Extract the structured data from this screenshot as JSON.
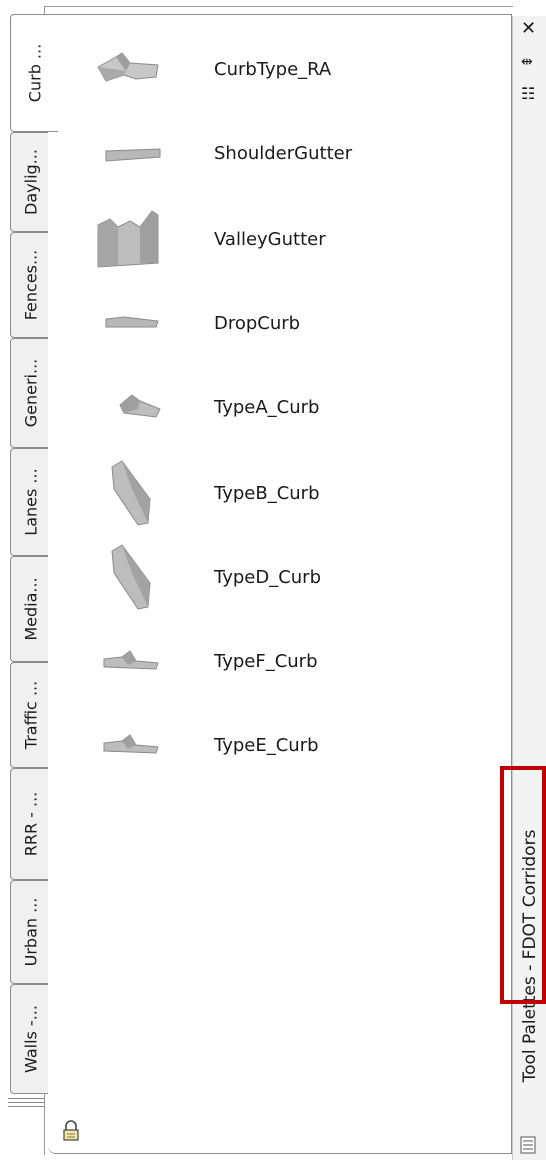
{
  "tabs": [
    {
      "label": "Curb ...",
      "active": true
    },
    {
      "label": "Daylig...",
      "active": false
    },
    {
      "label": "Fences...",
      "active": false
    },
    {
      "label": "Generi...",
      "active": false
    },
    {
      "label": "Lanes ...",
      "active": false
    },
    {
      "label": "Media...",
      "active": false
    },
    {
      "label": "Traffic ...",
      "active": false
    },
    {
      "label": "RRR - ...",
      "active": false
    },
    {
      "label": "Urban ...",
      "active": false
    },
    {
      "label": "Walls -...",
      "active": false
    }
  ],
  "tools": [
    {
      "label": "CurbType_RA",
      "icon": "curb-ra-icon"
    },
    {
      "label": "ShoulderGutter",
      "icon": "shoulder-gutter-icon"
    },
    {
      "label": "ValleyGutter",
      "icon": "valley-gutter-icon"
    },
    {
      "label": "DropCurb",
      "icon": "drop-curb-icon"
    },
    {
      "label": "TypeA_Curb",
      "icon": "type-a-curb-icon"
    },
    {
      "label": "TypeB_Curb",
      "icon": "type-b-curb-icon"
    },
    {
      "label": "TypeD_Curb",
      "icon": "type-d-curb-icon"
    },
    {
      "label": "TypeF_Curb",
      "icon": "type-f-curb-icon"
    },
    {
      "label": "TypeE_Curb",
      "icon": "type-e-curb-icon"
    }
  ],
  "titlebar": {
    "title": "Tool Palettes - FDOT Corridors",
    "close_glyph": "✕",
    "autohide_glyph": "⇹",
    "properties_glyph": "☷"
  },
  "colors": {
    "highlight": "#c00000",
    "icon_fill": "#b8b8b8"
  }
}
